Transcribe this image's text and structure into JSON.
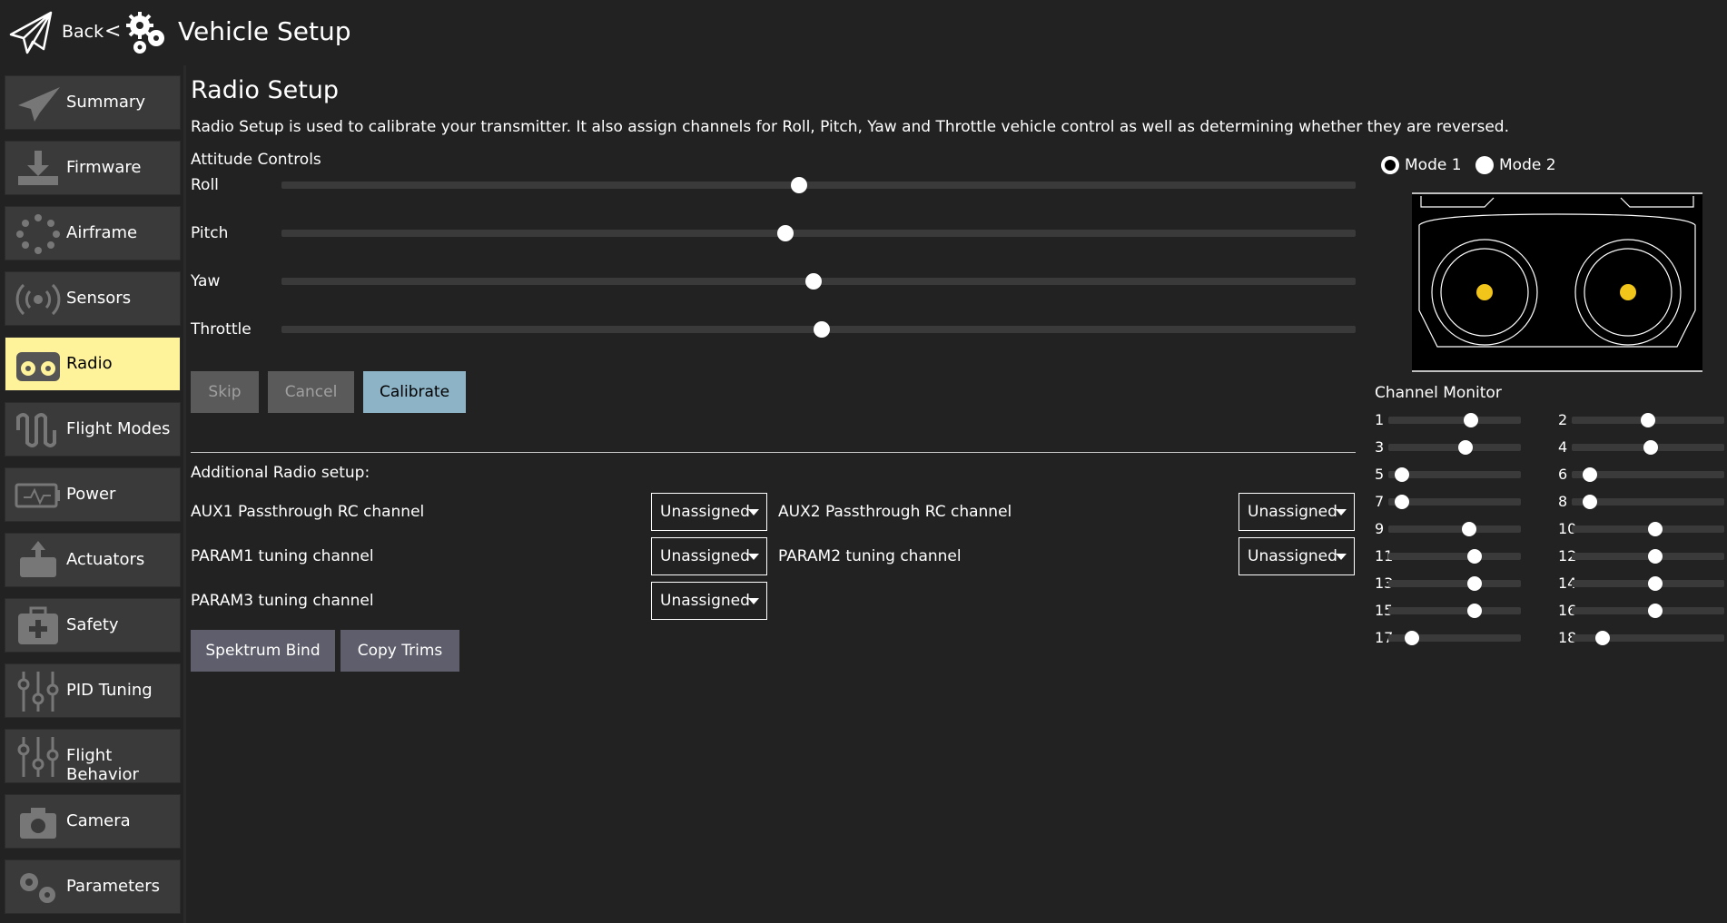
{
  "header": {
    "back_label": "Back",
    "separator": "<",
    "title": "Vehicle Setup"
  },
  "sidebar": {
    "items": [
      {
        "label": "Summary",
        "icon": "paper-plane-icon",
        "active": false
      },
      {
        "label": "Firmware",
        "icon": "download-icon",
        "active": false
      },
      {
        "label": "Airframe",
        "icon": "airframe-dots-icon",
        "active": false
      },
      {
        "label": "Sensors",
        "icon": "sensor-waves-icon",
        "active": false
      },
      {
        "label": "Radio",
        "icon": "radio-transmitter-icon",
        "active": true
      },
      {
        "label": "Flight Modes",
        "icon": "wave-icon",
        "active": false
      },
      {
        "label": "Power",
        "icon": "battery-icon",
        "active": false
      },
      {
        "label": "Actuators",
        "icon": "actuator-icon",
        "active": false
      },
      {
        "label": "Safety",
        "icon": "first-aid-icon",
        "active": false
      },
      {
        "label": "PID Tuning",
        "icon": "sliders-icon",
        "active": false
      },
      {
        "label": "Flight Behavior",
        "icon": "sliders-icon",
        "active": false
      },
      {
        "label": "Camera",
        "icon": "camera-icon",
        "active": false
      },
      {
        "label": "Parameters",
        "icon": "gears-icon",
        "active": false
      }
    ],
    "active_color": "#fef39a"
  },
  "page": {
    "title": "Radio Setup",
    "description": "Radio Setup is used to calibrate your transmitter. It also assign channels for Roll, Pitch, Yaw and Throttle vehicle control as well as determining whether they are reversed.",
    "attitude_heading": "Attitude Controls",
    "attitude": [
      {
        "label": "Roll",
        "value": 0.482
      },
      {
        "label": "Pitch",
        "value": 0.469
      },
      {
        "label": "Yaw",
        "value": 0.495
      },
      {
        "label": "Throttle",
        "value": 0.503
      }
    ],
    "buttons": {
      "skip": "Skip",
      "cancel": "Cancel",
      "calibrate": "Calibrate"
    },
    "additional_heading": "Additional Radio setup:",
    "channels": {
      "aux1": {
        "label": "AUX1 Passthrough RC channel",
        "value": "Unassigned"
      },
      "aux2": {
        "label": "AUX2 Passthrough RC channel",
        "value": "Unassigned"
      },
      "param1": {
        "label": "PARAM1 tuning channel",
        "value": "Unassigned"
      },
      "param2": {
        "label": "PARAM2 tuning channel",
        "value": "Unassigned"
      },
      "param3": {
        "label": "PARAM3 tuning channel",
        "value": "Unassigned"
      }
    },
    "bottom_buttons": {
      "spektrum": "Spektrum Bind",
      "copy_trims": "Copy Trims"
    },
    "modes": {
      "mode1": "Mode 1",
      "mode2": "Mode 2",
      "selected": "Mode 1"
    },
    "stick_color": "#f2c51a",
    "channel_monitor": {
      "title": "Channel Monitor",
      "channels": [
        {
          "n": "1",
          "value": 0.62
        },
        {
          "n": "2",
          "value": 0.5
        },
        {
          "n": "3",
          "value": 0.58
        },
        {
          "n": "4",
          "value": 0.52
        },
        {
          "n": "5",
          "value": 0.1
        },
        {
          "n": "6",
          "value": 0.12
        },
        {
          "n": "7",
          "value": 0.1
        },
        {
          "n": "8",
          "value": 0.12
        },
        {
          "n": "9",
          "value": 0.61
        },
        {
          "n": "10",
          "value": 0.55
        },
        {
          "n": "11",
          "value": 0.65
        },
        {
          "n": "12",
          "value": 0.55
        },
        {
          "n": "13",
          "value": 0.65
        },
        {
          "n": "14",
          "value": 0.55
        },
        {
          "n": "15",
          "value": 0.65
        },
        {
          "n": "16",
          "value": 0.55
        },
        {
          "n": "17",
          "value": 0.18
        },
        {
          "n": "18",
          "value": 0.2
        }
      ]
    }
  }
}
